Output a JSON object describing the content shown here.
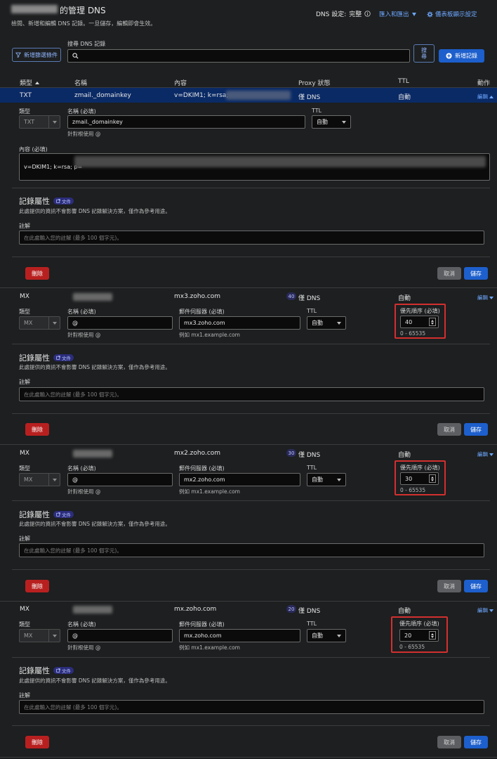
{
  "header": {
    "title_suffix": "的管理 DNS",
    "subtitle": "檢閱、新增和編輯 DNS 記錄。一旦儲存，編輯即會生效。",
    "dns_setting_label": "DNS 設定:",
    "dns_setting_value": "完整",
    "import_export": "匯入和匯出",
    "dashboard_display": "儀表板顯示設定"
  },
  "toolbar": {
    "filter_button": "新增篩選條件",
    "search_label": "搜尋 DNS 記錄",
    "search_value": "",
    "search_button": "搜尋",
    "add_record": "新增記錄"
  },
  "columns": {
    "type": "類型",
    "name": "名稱",
    "content": "內容",
    "proxy": "Proxy 狀態",
    "ttl": "TTL",
    "actions": "動作"
  },
  "common": {
    "type_label": "類型",
    "name_label": "名稱 (必填)",
    "name_hint": "針對根使用 @",
    "ttl_label": "TTL",
    "ttl_value": "自動",
    "mail_server_label": "郵件伺服器 (必填)",
    "mail_server_hint": "例如 mx1.example.com",
    "priority_label": "優先順序 (必填)",
    "priority_hint": "0 - 65535",
    "attrs_title": "記錄屬性",
    "doc_tag": "文件",
    "attrs_desc": "此處提供的資訊不會影響 DNS 記錄解決方案，僅作為參考用途。",
    "comment_label": "註解",
    "comment_placeholder": "在此處輸入您的註解 (最多 100 個字元)。",
    "delete": "刪除",
    "cancel": "取消",
    "save": "儲存",
    "edit": "編輯",
    "proxy_value": "僅 DNS",
    "ttl_auto": "自動"
  },
  "txt_record": {
    "type": "TXT",
    "name": "zmail._domainkey",
    "content": "v=DKIM1; k=rsa;",
    "content_label": "內容 (必填)",
    "content_value": "v=DKIM1; k=rsa; p="
  },
  "mx_records": [
    {
      "type": "MX",
      "content": "mx3.zoho.com",
      "priority": "40",
      "name_value": "@"
    },
    {
      "type": "MX",
      "content": "mx2.zoho.com",
      "priority": "30",
      "name_value": "@"
    },
    {
      "type": "MX",
      "content": "mx.zoho.com",
      "priority": "20",
      "name_value": "@"
    }
  ]
}
